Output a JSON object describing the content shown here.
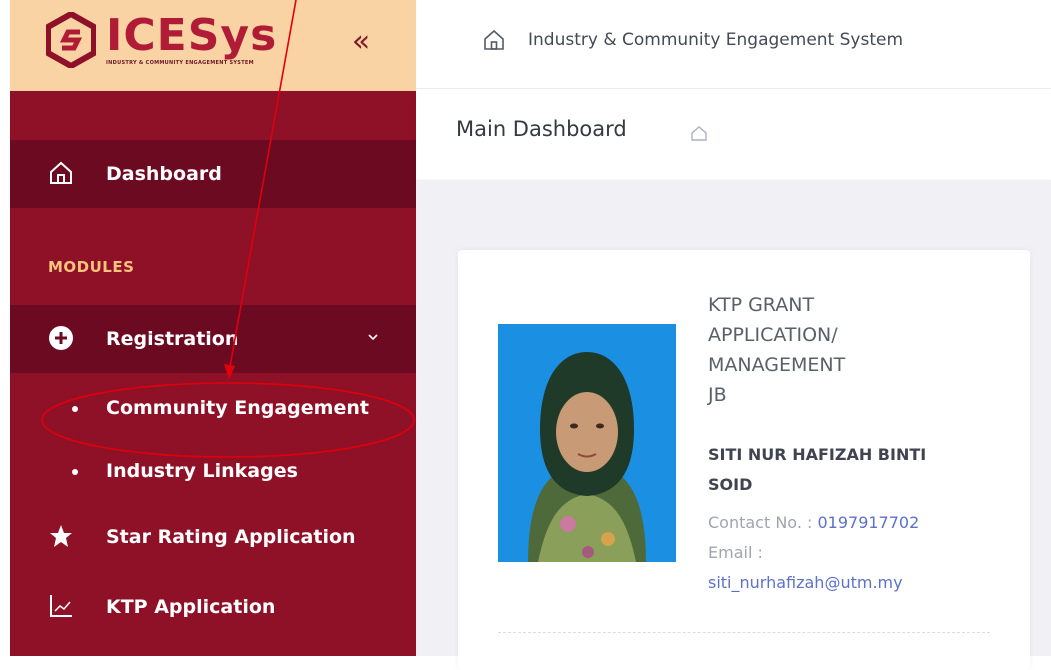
{
  "brand": {
    "name": "ICESys",
    "tagline": "INDUSTRY & COMMUNITY ENGAGEMENT SYSTEM",
    "logo_color": "#b01c35"
  },
  "sidebar": {
    "collapse_icon": "double-chevron-left-icon",
    "items": [
      {
        "label": "Dashboard",
        "icon": "home-icon"
      }
    ],
    "section_title": "MODULES",
    "modules": [
      {
        "label": "Registration",
        "icon": "plus-circle-icon"
      },
      {
        "label": "Community Engagement"
      },
      {
        "label": "Industry Linkages"
      },
      {
        "label": "Star Rating Application",
        "icon": "star-icon"
      },
      {
        "label": "KTP Application",
        "icon": "chart-line-icon"
      }
    ]
  },
  "topbar": {
    "title": "Industry & Community Engagement System"
  },
  "page": {
    "title": "Main Dashboard"
  },
  "profile": {
    "role": "KTP GRANT\nAPPLICATION/\nMANAGEMENT\nJB",
    "name": "SITI NUR HAFIZAH BINTI SOID",
    "contact_label": "Contact No. : ",
    "contact_value": "0197917702",
    "email_label": "Email :",
    "email_value": "siti_nurhafizah@utm.my"
  },
  "colors": {
    "sidebar_bg": "#8f1128",
    "sidebar_active": "#6c0a22",
    "brand_bg": "#fad3a5",
    "section_title": "#ffc37d",
    "annotation": "#e0000a"
  }
}
